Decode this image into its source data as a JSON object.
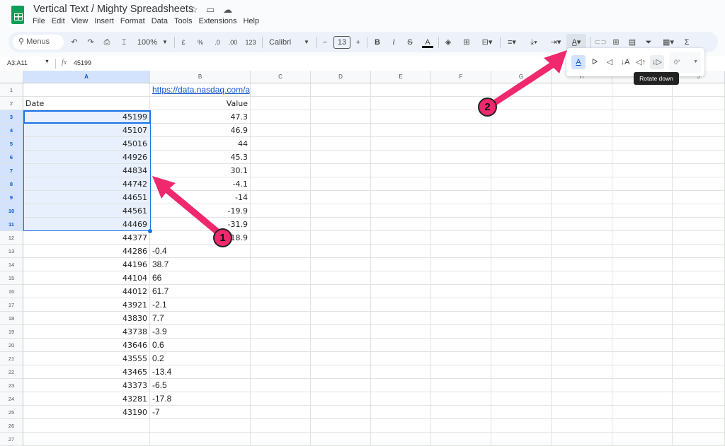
{
  "app": {
    "title": "Vertical Text / Mighty Spreadsheets",
    "menu": [
      "File",
      "Edit",
      "View",
      "Insert",
      "Format",
      "Data",
      "Tools",
      "Extensions",
      "Help"
    ]
  },
  "toolbar": {
    "search": "Menus",
    "zoom": "100%",
    "currency": "£",
    "percent": "%",
    "dec_less": ".0",
    "dec_more": ".00",
    "format_more": "123",
    "font": "Calibri",
    "font_size": "13",
    "bold": "B",
    "italic": "I",
    "sum": "Σ"
  },
  "formula_bar": {
    "name_box": "A3:A11",
    "fx": "fx",
    "value": "45199"
  },
  "rotation_menu": {
    "angle": "0°",
    "tooltip": "Rotate down"
  },
  "columns": [
    "A",
    "B",
    "C",
    "D",
    "E",
    "F",
    "G",
    "H",
    "I",
    "J"
  ],
  "cells": {
    "B1": "https://data.nasdaq.com/ap",
    "A2": "Date",
    "B2": "Value"
  },
  "rows": [
    {
      "n": "3",
      "a": "45199",
      "b": "47.3"
    },
    {
      "n": "4",
      "a": "45107",
      "b": "46.9"
    },
    {
      "n": "5",
      "a": "45016",
      "b": "44"
    },
    {
      "n": "6",
      "a": "44926",
      "b": "45.3"
    },
    {
      "n": "7",
      "a": "44834",
      "b": "30.1"
    },
    {
      "n": "8",
      "a": "44742",
      "b": "-4.1"
    },
    {
      "n": "9",
      "a": "44651",
      "b": "-14"
    },
    {
      "n": "10",
      "a": "44561",
      "b": "-19.9"
    },
    {
      "n": "11",
      "a": "44469",
      "b": "-31.9"
    },
    {
      "n": "12",
      "a": "44377",
      "b": "-18.9"
    },
    {
      "n": "13",
      "a": "44286",
      "b": "-0.4"
    },
    {
      "n": "14",
      "a": "44196",
      "b": "38.7"
    },
    {
      "n": "15",
      "a": "44104",
      "b": "66"
    },
    {
      "n": "16",
      "a": "44012",
      "b": "61.7"
    },
    {
      "n": "17",
      "a": "43921",
      "b": "-2.1"
    },
    {
      "n": "18",
      "a": "43830",
      "b": "7.7"
    },
    {
      "n": "19",
      "a": "43738",
      "b": "-3.9"
    },
    {
      "n": "20",
      "a": "43646",
      "b": "0.6"
    },
    {
      "n": "21",
      "a": "43555",
      "b": "0.2"
    },
    {
      "n": "22",
      "a": "43465",
      "b": "-13.4"
    },
    {
      "n": "23",
      "a": "43373",
      "b": "-6.5"
    },
    {
      "n": "24",
      "a": "43281",
      "b": "-17.8"
    },
    {
      "n": "25",
      "a": "43190",
      "b": "-7"
    }
  ],
  "extra_rows": [
    "1",
    "2",
    "26",
    "27"
  ],
  "annotations": {
    "badge1": "1",
    "badge2": "2",
    "color": "#f0286e"
  }
}
